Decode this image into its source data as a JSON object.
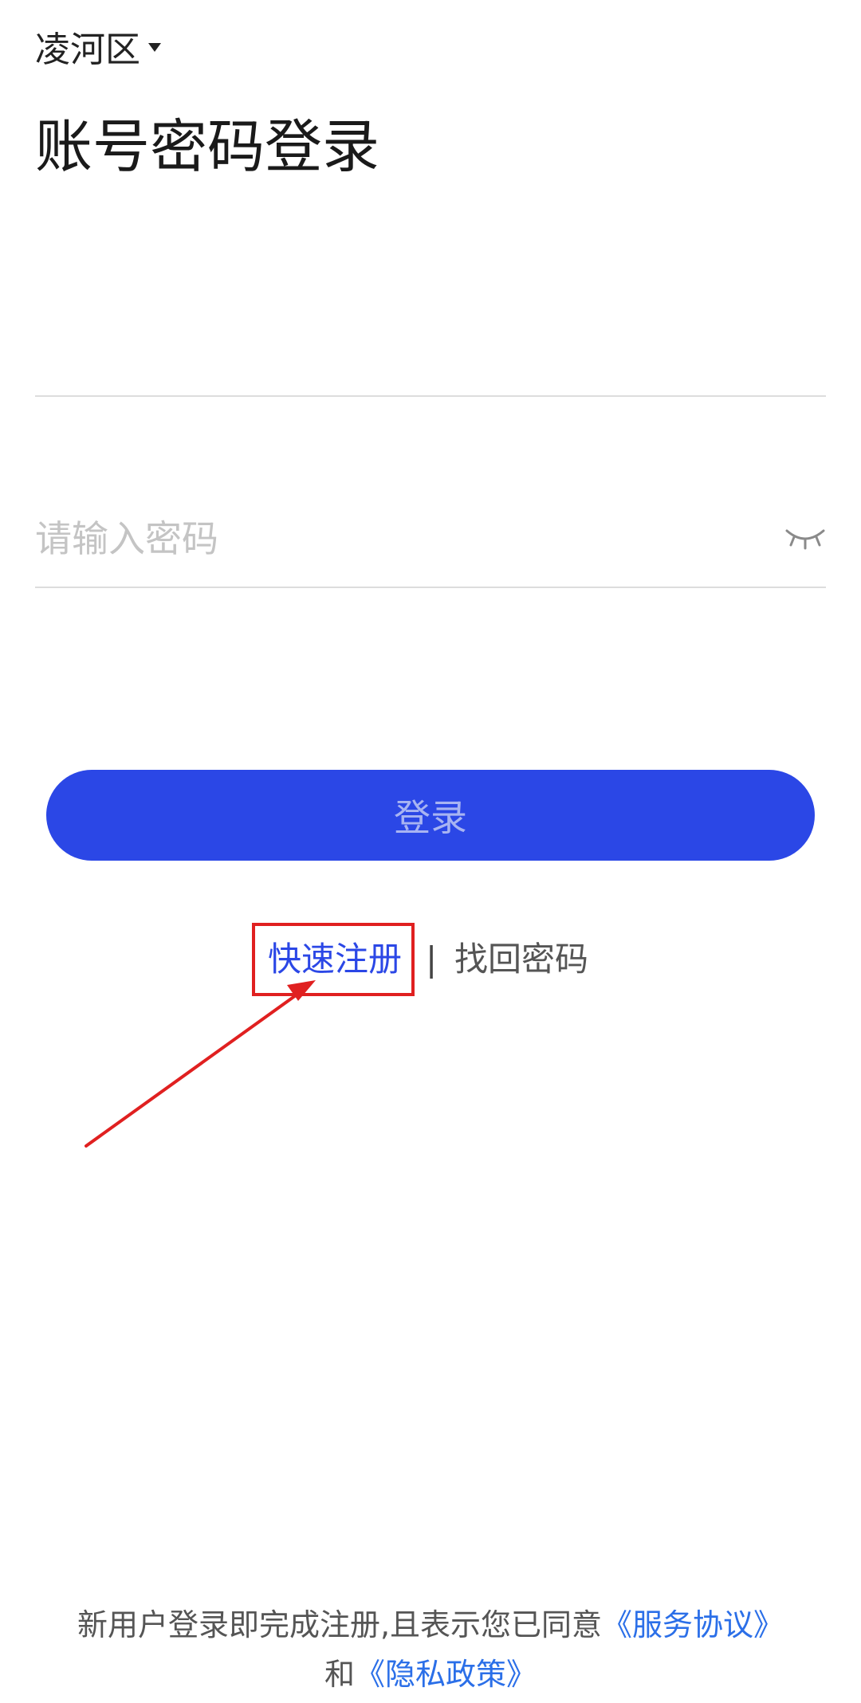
{
  "header": {
    "region": "凌河区"
  },
  "login": {
    "title": "账号密码登录",
    "account": {
      "value": "",
      "placeholder": ""
    },
    "password": {
      "value": "",
      "placeholder": "请输入密码"
    },
    "submit_label": "登录"
  },
  "links": {
    "register": "快速注册",
    "divider": "|",
    "recover": "找回密码"
  },
  "agreement": {
    "prefix": "新用户登录即完成注册,且表示您已同意",
    "service": "《服务协议》",
    "conjunction": "和",
    "privacy": "《隐私政策》"
  },
  "colors": {
    "primary": "#2b47e6",
    "button_text": "#a8b4f2",
    "link": "#2b6fe8",
    "annotation": "#e02020"
  },
  "icons": {
    "region_dropdown": "caret-down-icon",
    "password_toggle": "eye-closed-icon"
  }
}
